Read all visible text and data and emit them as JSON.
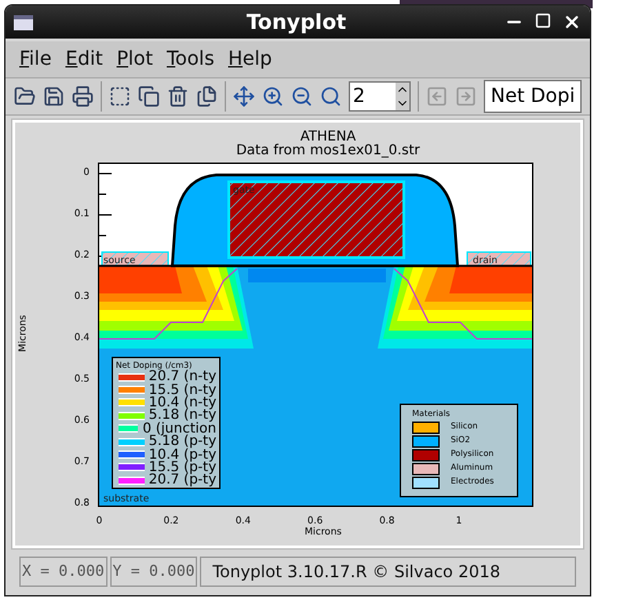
{
  "window": {
    "title": "Tonyplot"
  },
  "menu": [
    {
      "label": "File"
    },
    {
      "label": "Edit"
    },
    {
      "label": "Plot"
    },
    {
      "label": "Tools"
    },
    {
      "label": "Help"
    }
  ],
  "toolbar": {
    "zoom_value": "2",
    "dataset": "Net Dopi"
  },
  "plot": {
    "title": "ATHENA",
    "subtitle": "Data from mos1ex01_0.str",
    "xlabel": "Microns",
    "ylabel": "Microns",
    "xticks": [
      "0",
      "0.2",
      "0.4",
      "0.6",
      "0.8",
      "1"
    ],
    "yticks": [
      "0",
      "0.1",
      "0.2",
      "0.3",
      "0.4",
      "0.5",
      "0.6",
      "0.7",
      "0.8"
    ],
    "region_labels": [
      {
        "kind": "gate",
        "label": "gate"
      },
      {
        "kind": "source",
        "label": "source"
      },
      {
        "kind": "drain",
        "label": "drain"
      },
      {
        "kind": "substrate",
        "label": "substrate"
      }
    ],
    "doping_legend": {
      "title": "Net Doping (/cm3)",
      "items": [
        {
          "label": "20.7 (n-ty",
          "color": "#e83010"
        },
        {
          "label": "15.5 (n-ty",
          "color": "#ff8000"
        },
        {
          "label": "10.4 (n-ty",
          "color": "#ffe000"
        },
        {
          "label": "5.18 (n-ty",
          "color": "#80ff00"
        },
        {
          "label": "0 (junction",
          "color": "#00ffa0"
        },
        {
          "label": "5.18 (p-ty",
          "color": "#00d0ff"
        },
        {
          "label": "10.4 (p-ty",
          "color": "#2060ff"
        },
        {
          "label": "15.5 (p-ty",
          "color": "#8020ff"
        },
        {
          "label": "20.7 (p-ty",
          "color": "#ff20ff"
        }
      ]
    },
    "materials_legend": {
      "title": "Materials",
      "items": [
        {
          "label": "Silicon",
          "color": "#ffb000"
        },
        {
          "label": "SiO2",
          "color": "#00b0ff"
        },
        {
          "label": "Polysilicon",
          "color": "#b00000"
        },
        {
          "label": "Aluminum",
          "color": "#e8b8b8"
        },
        {
          "label": "Electrodes",
          "color": "#a0e0ff"
        }
      ]
    }
  },
  "status_bar": {
    "x": "X = 0.000",
    "y": "Y = 0.000",
    "version": "Tonyplot 3.10.17.R © Silvaco 2018"
  }
}
